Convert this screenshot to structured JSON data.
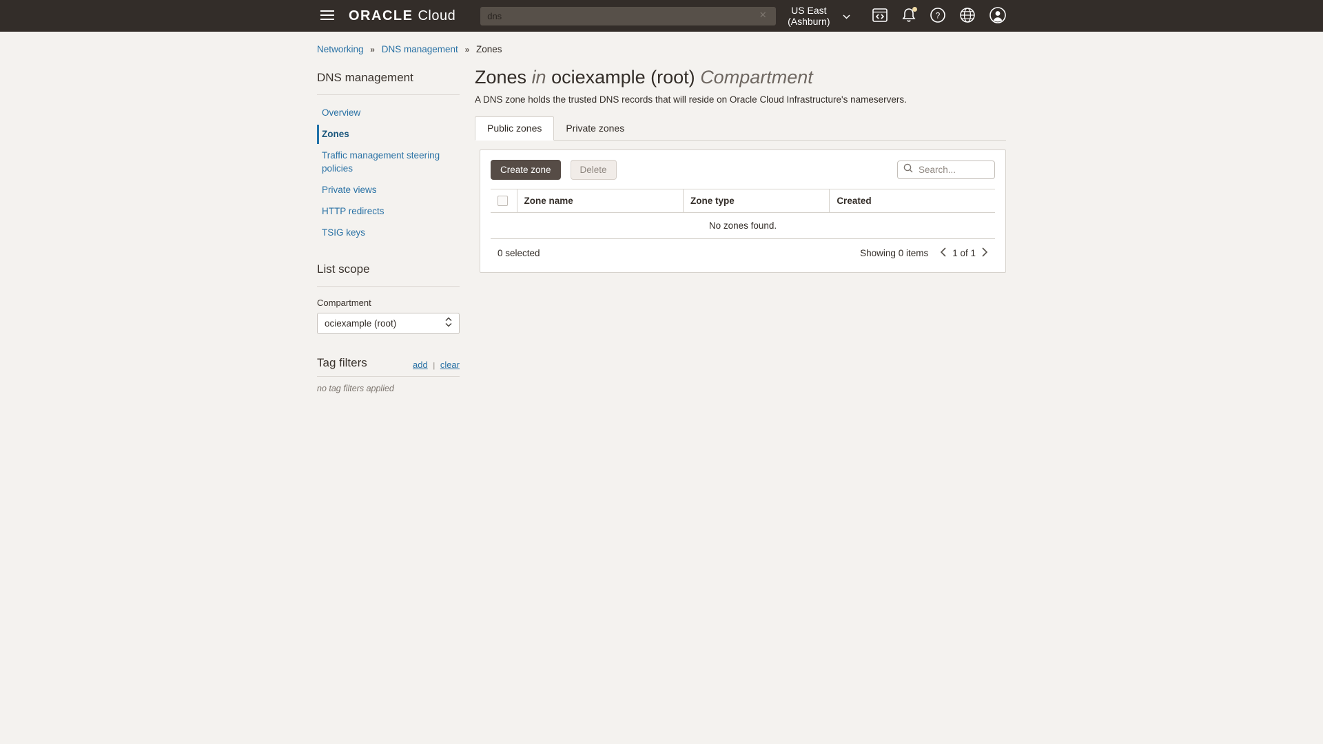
{
  "header": {
    "logo": {
      "oracle": "ORACLE",
      "cloud": "Cloud"
    },
    "search": {
      "value": "dns"
    },
    "region": {
      "label": "US East (Ashburn)"
    },
    "icons": [
      "hamburger-icon",
      "cloud-shell-icon",
      "notifications-bell-icon",
      "help-icon",
      "language-globe-icon",
      "profile-avatar-icon"
    ]
  },
  "breadcrumb": {
    "separator": "»",
    "items": [
      {
        "label": "Networking"
      },
      {
        "label": "DNS management"
      },
      {
        "label": "Zones"
      }
    ]
  },
  "sidebar": {
    "title": "DNS management",
    "items": [
      {
        "label": "Overview",
        "active": false
      },
      {
        "label": "Zones",
        "active": true
      },
      {
        "label": "Traffic management steering policies",
        "active": false
      },
      {
        "label": "Private views",
        "active": false
      },
      {
        "label": "HTTP redirects",
        "active": false
      },
      {
        "label": "TSIG keys",
        "active": false
      }
    ],
    "list_scope": {
      "title": "List scope",
      "compartment_label": "Compartment",
      "compartment_value": "ociexample (root)"
    },
    "tag_filters": {
      "title": "Tag filters",
      "add_label": "add",
      "separator": "|",
      "clear_label": "clear",
      "empty_text": "no tag filters applied"
    }
  },
  "main": {
    "title": {
      "part1": "Zones",
      "part2": "in",
      "part3": "ociexample (root)",
      "part4": "Compartment"
    },
    "subtitle": "A DNS zone holds the trusted DNS records that will reside on Oracle Cloud Infrastructure's nameservers.",
    "tabs": [
      {
        "label": "Public zones",
        "active": true
      },
      {
        "label": "Private zones",
        "active": false
      }
    ],
    "panel": {
      "create_button": "Create zone",
      "delete_button": "Delete",
      "search_placeholder": "Search...",
      "table": {
        "columns": [
          "Zone name",
          "Zone type",
          "Created"
        ],
        "rows": [],
        "empty_message": "No zones found."
      },
      "footer": {
        "selected_text": "0 selected",
        "showing_text": "Showing 0 items",
        "page_text": "1 of 1"
      }
    }
  },
  "colors": {
    "topbar_background": "#332d29",
    "page_background": "#f4f2ef",
    "link_blue": "#2a72a5",
    "active_nav_blue": "#2172a9",
    "primary_button": "#564c46",
    "notification_badge": "#eed9a5"
  }
}
